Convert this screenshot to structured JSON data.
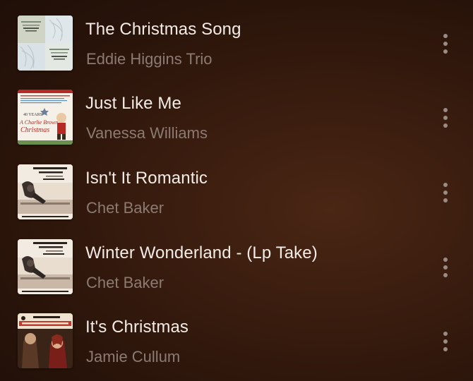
{
  "songs": [
    {
      "title": "The Christmas Song",
      "artist": "Eddie Higgins Trio",
      "artwork_icon": "album-art-eddie-higgins-christmas"
    },
    {
      "title": "Just Like Me",
      "artist": "Vanessa Williams",
      "artwork_icon": "album-art-charlie-brown-christmas"
    },
    {
      "title": "Isn't It Romantic",
      "artist": "Chet Baker",
      "artwork_icon": "album-art-chet-baker-quartet"
    },
    {
      "title": "Winter Wonderland - (Lp Take)",
      "artist": "Chet Baker",
      "artwork_icon": "album-art-chet-baker-quartet"
    },
    {
      "title": "It's Christmas",
      "artist": "Jamie Cullum",
      "artwork_icon": "album-art-jamie-cullum-pianoman"
    }
  ],
  "more_icon": "ellipsis-vertical-icon",
  "colors": {
    "background": "#2e170b",
    "title_text": "#f3ece6",
    "artist_text": "#8b7b72",
    "more_dots": "#9a8c84"
  }
}
